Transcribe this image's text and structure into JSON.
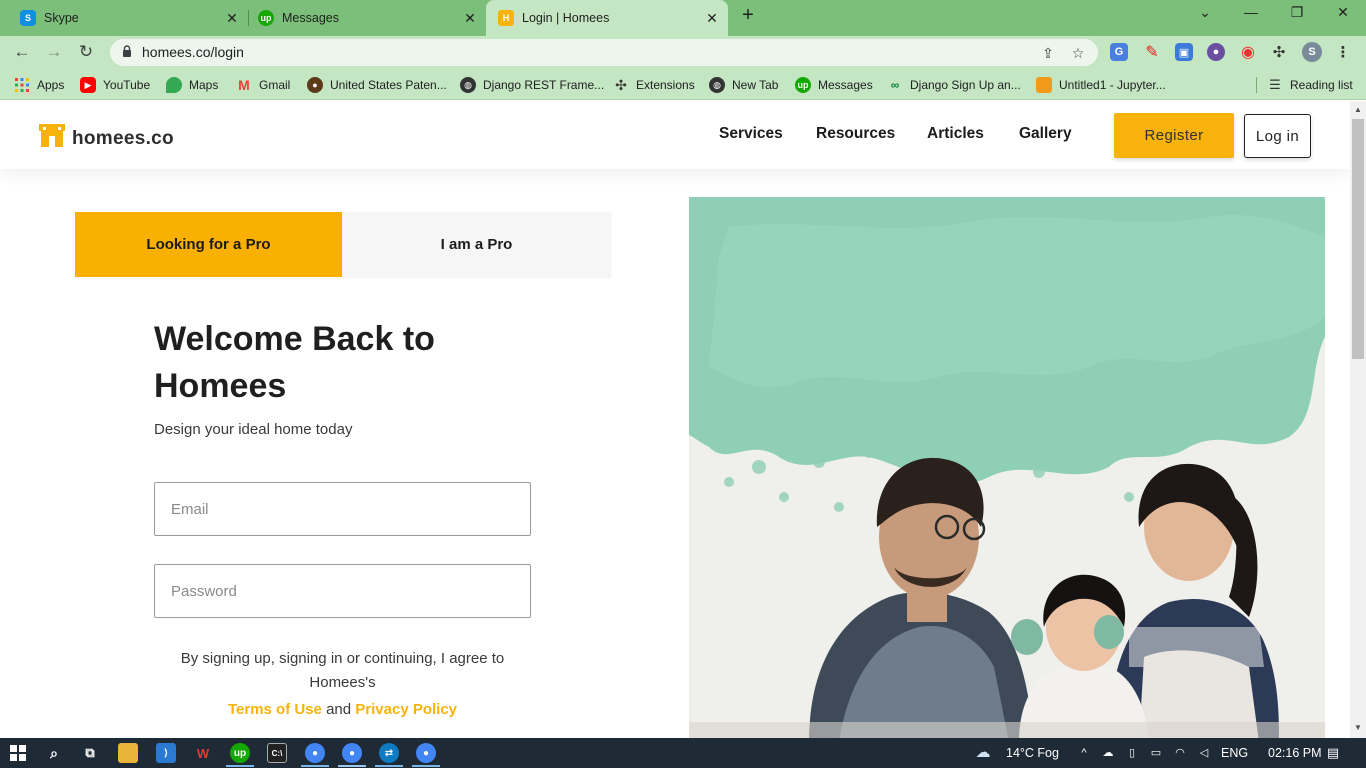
{
  "browser": {
    "tabs": [
      {
        "title": "Skype",
        "favicon": "skype-icon",
        "color": "#0f8fe0",
        "letter": "S"
      },
      {
        "title": "Messages",
        "favicon": "upwork-icon",
        "color": "#14a800",
        "letter": "up"
      },
      {
        "title": "Login | Homees",
        "favicon": "homees-icon",
        "color": "#f7b30b",
        "letter": "H"
      }
    ],
    "url": "homees.co/login",
    "bookmarks": [
      {
        "label": "Apps",
        "icon": "apps-grid-icon"
      },
      {
        "label": "YouTube",
        "icon": "youtube-icon"
      },
      {
        "label": "Maps",
        "icon": "maps-icon"
      },
      {
        "label": "Gmail",
        "icon": "gmail-icon"
      },
      {
        "label": "United States Paten...",
        "icon": "patent-icon"
      },
      {
        "label": "Django REST Frame...",
        "icon": "globe-icon"
      },
      {
        "label": "Extensions",
        "icon": "puzzle-icon"
      },
      {
        "label": "New Tab",
        "icon": "globe-icon"
      },
      {
        "label": "Messages",
        "icon": "upwork-icon"
      },
      {
        "label": "Django Sign Up an...",
        "icon": "link-icon"
      },
      {
        "label": "Untitled1 - Jupyter...",
        "icon": "jupyter-icon"
      }
    ],
    "reading_list": "Reading list",
    "profile_initial": "S"
  },
  "site": {
    "logo_text": "homees.co",
    "nav": [
      "Services",
      "Resources",
      "Articles",
      "Gallery"
    ],
    "register_label": "Register",
    "login_label": "Log in",
    "brand_color": "#f7b30b"
  },
  "login": {
    "tab_seeker": "Looking for a Pro",
    "tab_pro": "I am a Pro",
    "title": "Welcome Back to Homees",
    "subtitle": "Design your ideal home today",
    "email_placeholder": "Email",
    "password_placeholder": "Password",
    "agree_text": "By signing up, signing in or continuing, I agree to Homees's",
    "terms_label": "Terms of Use",
    "and_text": "and",
    "privacy_label": "Privacy Policy"
  },
  "taskbar": {
    "weather": "14°C  Fog",
    "language": "ENG",
    "time": "02:16 PM"
  }
}
